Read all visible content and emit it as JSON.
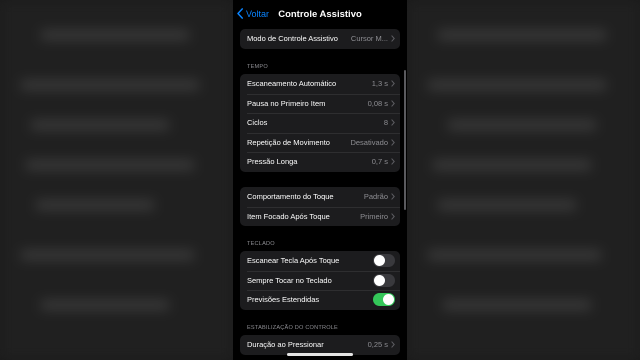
{
  "nav": {
    "back_label": "Voltar",
    "title": "Controle Assistivo"
  },
  "top_group": {
    "items": [
      {
        "label": "Modo de Controle Assistivo",
        "value": "Cursor M..."
      }
    ]
  },
  "tempo": {
    "header": "TEMPO",
    "items": [
      {
        "label": "Escaneamento Automático",
        "value": "1,3 s"
      },
      {
        "label": "Pausa no Primeiro Item",
        "value": "0,08 s"
      },
      {
        "label": "Ciclos",
        "value": "8"
      },
      {
        "label": "Repetição de Movimento",
        "value": "Desativado"
      },
      {
        "label": "Pressão Longa",
        "value": "0,7 s"
      }
    ]
  },
  "toque": {
    "items": [
      {
        "label": "Comportamento do Toque",
        "value": "Padrão"
      },
      {
        "label": "Item Focado Após Toque",
        "value": "Primeiro"
      }
    ]
  },
  "teclado": {
    "header": "TECLADO",
    "items": [
      {
        "label": "Escanear Tecla Após Toque",
        "on": false
      },
      {
        "label": "Sempre Tocar no Teclado",
        "on": false
      },
      {
        "label": "Previsões Estendidas",
        "on": true
      }
    ]
  },
  "estabilizacao": {
    "header": "ESTABILIZAÇÃO DO CONTROLE",
    "items": [
      {
        "label": "Duração ao Pressionar",
        "value": "0,25 s"
      }
    ]
  },
  "colors": {
    "accent": "#0a84ff",
    "toggle_on": "#34c759",
    "cell_bg": "#1c1c1e",
    "secondary_text": "#8e8e93"
  },
  "icons": {
    "back": "chevron-left-icon",
    "disclosure": "chevron-right-icon"
  }
}
